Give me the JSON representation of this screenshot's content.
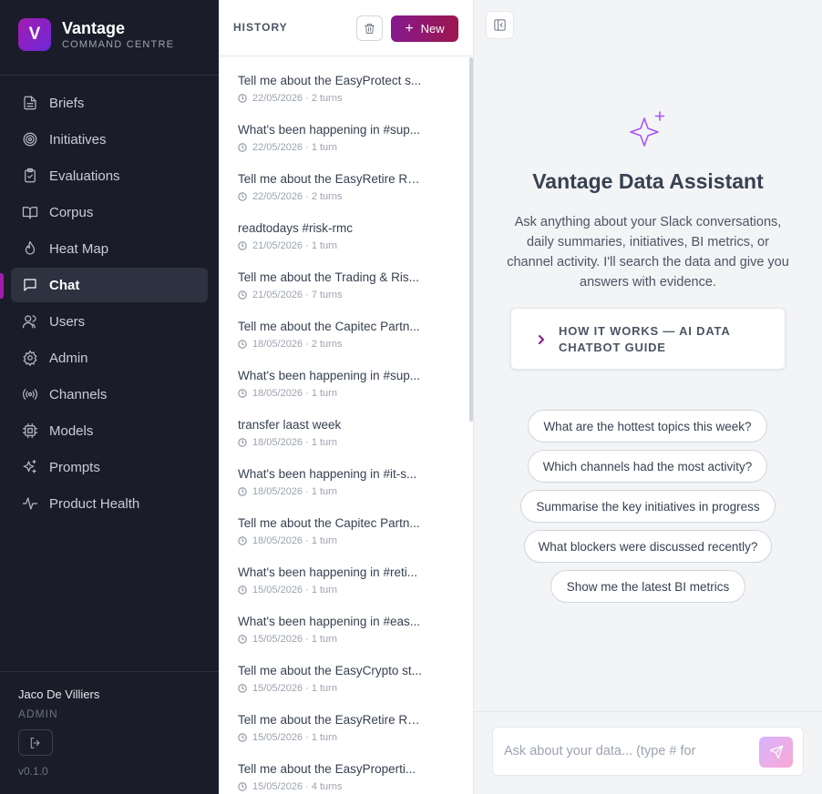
{
  "brand": {
    "logo_letter": "V",
    "name": "Vantage",
    "subtitle": "COMMAND CENTRE",
    "accent": "#a21caf"
  },
  "sidebar": {
    "items": [
      {
        "label": "Briefs",
        "icon": "document-icon"
      },
      {
        "label": "Initiatives",
        "icon": "target-icon"
      },
      {
        "label": "Evaluations",
        "icon": "clipboard-check-icon"
      },
      {
        "label": "Corpus",
        "icon": "book-open-icon"
      },
      {
        "label": "Heat Map",
        "icon": "flame-icon"
      },
      {
        "label": "Chat",
        "icon": "chat-icon",
        "active": true
      },
      {
        "label": "Users",
        "icon": "users-icon"
      },
      {
        "label": "Admin",
        "icon": "gear-icon"
      },
      {
        "label": "Channels",
        "icon": "broadcast-icon"
      },
      {
        "label": "Models",
        "icon": "chip-icon"
      },
      {
        "label": "Prompts",
        "icon": "sparkles-icon"
      },
      {
        "label": "Product Health",
        "icon": "activity-icon"
      }
    ],
    "user": {
      "name": "Jaco De Villiers",
      "role": "ADMIN"
    },
    "version": "v0.1.0"
  },
  "history": {
    "title": "HISTORY",
    "new_label": "New",
    "items": [
      {
        "title": "Tell me about the EasyProtect s...",
        "meta": "22/05/2026 · 2 turns"
      },
      {
        "title": "What's been happening in #sup...",
        "meta": "22/05/2026 · 1 turn"
      },
      {
        "title": "Tell me about the EasyRetire Re...",
        "meta": "22/05/2026 · 2 turns"
      },
      {
        "title": "readtodays #risk-rmc",
        "meta": "21/05/2026 · 1 turn"
      },
      {
        "title": "Tell me about the Trading & Ris...",
        "meta": "21/05/2026 · 7 turns"
      },
      {
        "title": "Tell me about the Capitec Partn...",
        "meta": "18/05/2026 · 2 turns"
      },
      {
        "title": "What's been happening in #sup...",
        "meta": "18/05/2026 · 1 turn"
      },
      {
        "title": "transfer laast week",
        "meta": "18/05/2026 · 1 turn"
      },
      {
        "title": "What's been happening in #it-s...",
        "meta": "18/05/2026 · 1 turn"
      },
      {
        "title": "Tell me about the Capitec Partn...",
        "meta": "18/05/2026 · 1 turn"
      },
      {
        "title": "What's been happening in #reti...",
        "meta": "15/05/2026 · 1 turn"
      },
      {
        "title": "What's been happening in #eas...",
        "meta": "15/05/2026 · 1 turn"
      },
      {
        "title": "Tell me about the EasyCrypto st...",
        "meta": "15/05/2026 · 1 turn"
      },
      {
        "title": "Tell me about the EasyRetire Re...",
        "meta": "15/05/2026 · 1 turn"
      },
      {
        "title": "Tell me about the EasyProperti...",
        "meta": "15/05/2026 · 4 turns"
      }
    ]
  },
  "main": {
    "title": "Vantage Data Assistant",
    "description": "Ask anything about your Slack conversations, daily summaries, initiatives, BI metrics, or channel activity. I'll search the data and give you answers with evidence.",
    "guide_label": "HOW IT WORKS — AI DATA CHATBOT GUIDE",
    "suggestions": [
      "What are the hottest topics this week?",
      "Which channels had the most activity?",
      "Summarise the key initiatives in progress",
      "What blockers were discussed recently?",
      "Show me the latest BI metrics"
    ],
    "input_placeholder": "Ask about your data... (type # for",
    "input_value": ""
  }
}
